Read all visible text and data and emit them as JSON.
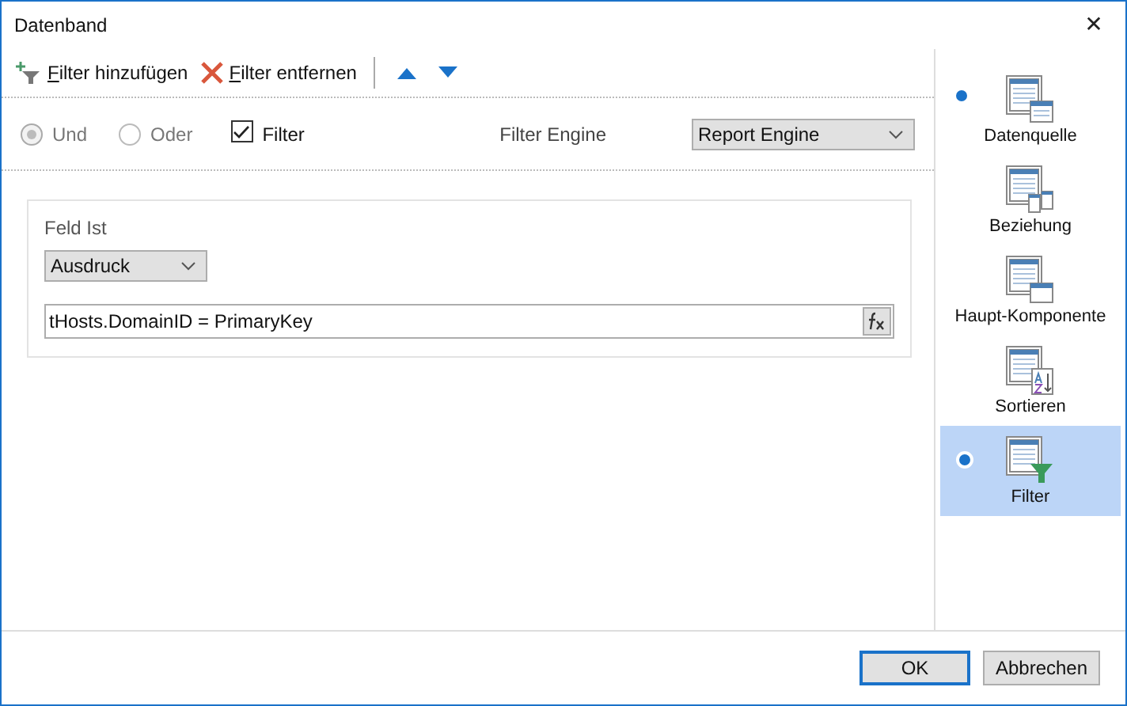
{
  "window": {
    "title": "Datenband",
    "close": "✕"
  },
  "toolbar": [
    {
      "kind": "add",
      "label": "Filter hinzufügen"
    },
    {
      "kind": "remove",
      "label": "Filter entfernen"
    },
    {
      "kind": "up"
    },
    {
      "kind": "down"
    }
  ],
  "options": {
    "radios": [
      {
        "label": "Und",
        "selected": true,
        "disabled": true
      },
      {
        "label": "Oder",
        "selected": false,
        "disabled": true
      }
    ],
    "checkbox": {
      "label": "Filter",
      "checked": true
    },
    "engine_label": "Filter Engine",
    "engine": "Report Engine"
  },
  "filter": {
    "label": "Feld Ist",
    "field": "Ausdruck",
    "expression": "tHosts.DomainID = PrimaryKey"
  },
  "sidebar": {
    "items": [
      {
        "kind": "source",
        "label": "Datenquelle",
        "marked": true,
        "selected": false
      },
      {
        "kind": "relation",
        "label": "Beziehung",
        "marked": false,
        "selected": false
      },
      {
        "kind": "master",
        "label": "Haupt-Komponente",
        "marked": false,
        "selected": false
      },
      {
        "kind": "sort",
        "label": "Sortieren",
        "marked": false,
        "selected": false
      },
      {
        "kind": "filter",
        "label": "Filter",
        "marked": true,
        "selected": true
      }
    ]
  },
  "buttons": [
    {
      "label": "OK",
      "default": true
    },
    {
      "label": "Abbrechen",
      "default": false
    }
  ]
}
